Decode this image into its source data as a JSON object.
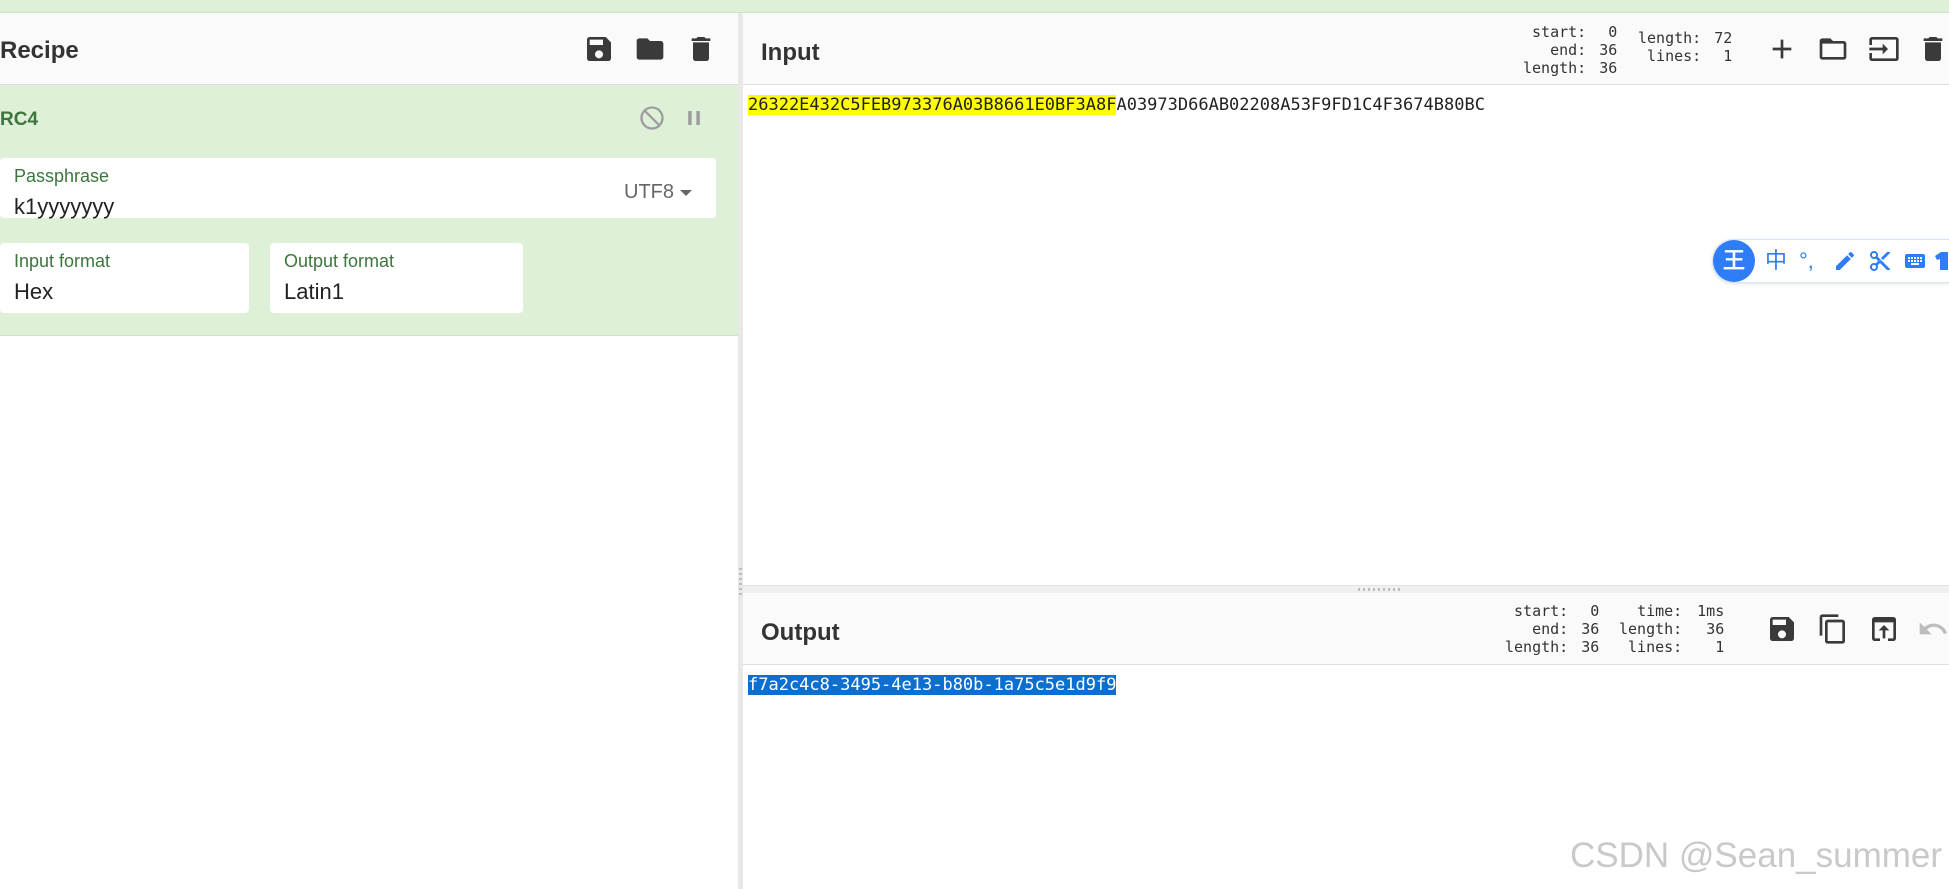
{
  "recipe": {
    "title": "Recipe",
    "save_icon": "save-icon",
    "open_icon": "folder-icon",
    "clear_icon": "trash-icon",
    "operation": {
      "name": "RC4",
      "disable_icon": "disable-icon",
      "pause_icon": "pause-icon",
      "passphrase": {
        "label": "Passphrase",
        "value": "k1yyyyyyy",
        "encoding": "UTF8"
      },
      "input_format": {
        "label": "Input format",
        "value": "Hex"
      },
      "output_format": {
        "label": "Output format",
        "value": "Latin1"
      }
    }
  },
  "input": {
    "title": "Input",
    "stats": {
      "start_label": "start:",
      "start": "0",
      "end_label": "end:",
      "end": "36",
      "sel_length_label": "length:",
      "sel_length": "36",
      "length_label": "length:",
      "length": "72",
      "lines_label": "lines:",
      "lines": "1"
    },
    "text_highlighted": "26322E432C5FEB973376A03B8661E0BF3A8F",
    "text_rest": "A03973D66AB02208A53F9FD1C4F3674B80BC"
  },
  "output": {
    "title": "Output",
    "stats": {
      "start_label": "start:",
      "start": "0",
      "end_label": "end:",
      "end": "36",
      "length_label": "length:",
      "length": "36",
      "time_label": "time:",
      "time": "1ms",
      "out_length_label": "length:",
      "out_length": "36",
      "lines_label": "lines:",
      "lines": "1"
    },
    "text": "f7a2c4c8-3495-4e13-b80b-1a75c5e1d9f9"
  },
  "ime_toolbar": {
    "logo": "王",
    "items": [
      "中",
      "°,"
    ]
  },
  "watermark": "CSDN @Sean_summer",
  "colors": {
    "recipe_green": "#dff0d8",
    "label_green": "#3c763d",
    "highlight_yellow": "#ffff00",
    "selection_blue": "#0b6fd1"
  }
}
